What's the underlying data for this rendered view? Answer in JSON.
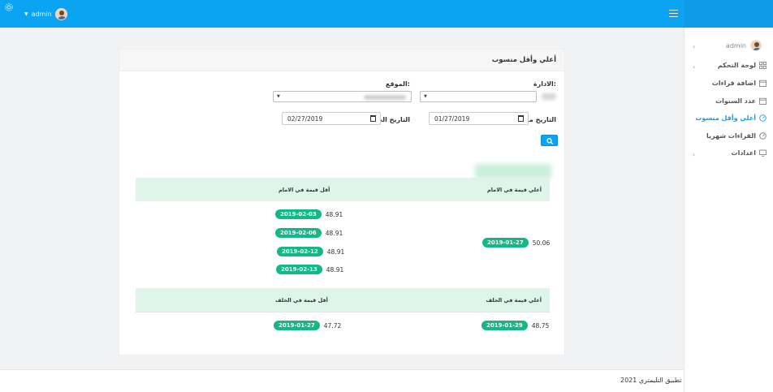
{
  "topbar": {
    "username": "admin",
    "accent": "#0aa4f2"
  },
  "sidebar": {
    "username": "admin",
    "items": [
      {
        "label": "لوحة التحكم",
        "icon": "grid-icon"
      },
      {
        "label": "اضافة قراءات",
        "icon": "calendar-icon"
      },
      {
        "label": "عدد السنوات",
        "icon": "calendar-icon"
      },
      {
        "label": "أعلي وأقل منسوب",
        "icon": "gauge-icon",
        "active": true
      },
      {
        "label": "القراءات شهريا",
        "icon": "gauge-icon"
      },
      {
        "label": "اعدادات",
        "icon": "monitor-icon"
      }
    ]
  },
  "page": {
    "title": "أعلي وأقل منسوب",
    "labels": {
      "department": "الادارة:",
      "location": "الموقع:",
      "date_from": "التاريخ من",
      "date_to": "التاريخ الي"
    },
    "date_from": "01/27/2019",
    "date_to": "02/27/2019"
  },
  "front": {
    "header_max": "أعلي قيمة في الامام",
    "header_min": "أقل قيمة في الامام",
    "max": {
      "value": "50.06",
      "date": "2019-01-27"
    },
    "min": [
      {
        "value": "48.91",
        "date": "2019-02-03"
      },
      {
        "value": "48.91",
        "date": "2019-02-06"
      },
      {
        "value": "48.91",
        "date": "2019-02-12"
      },
      {
        "value": "48.91",
        "date": "2019-02-13"
      }
    ]
  },
  "back": {
    "header_max": "أعلي قيمة في الخلف",
    "header_min": "أقل قيمة في الخلف",
    "max": {
      "value": "48.75",
      "date": "2019-01-29"
    },
    "min": {
      "value": "47.72",
      "date": "2019-01-27"
    }
  },
  "footer": {
    "app_name": "تطبيق التليمتري",
    "year": "2021"
  },
  "colors": {
    "badge": "#12b886",
    "table_header": "#dff5ea",
    "active_link": "#1a9ee8"
  }
}
